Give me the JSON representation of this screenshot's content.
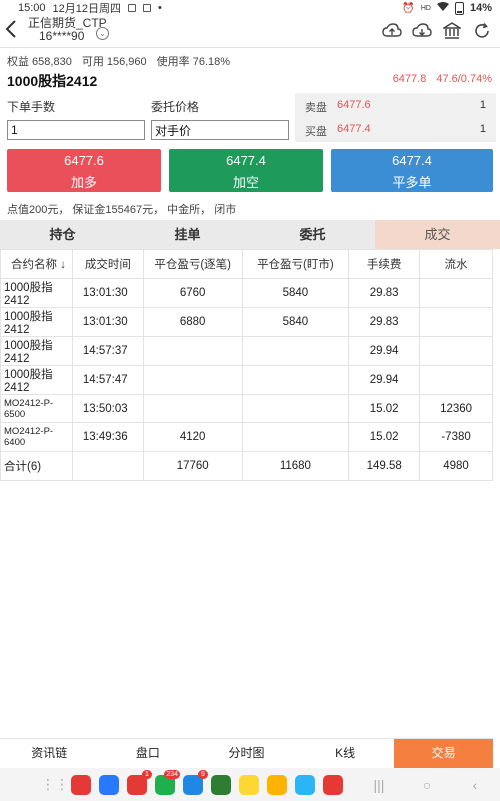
{
  "status": {
    "time": "15:00",
    "date": "12月12日周四",
    "battery": "14%",
    "net": "HD"
  },
  "header": {
    "account_name": "正信期货_CTP",
    "account_id": "16****90"
  },
  "equity": {
    "equity": "权益 658,830",
    "available": "可用 156,960",
    "usage": "使用率 76.18%"
  },
  "contract": {
    "name": "1000股指2412",
    "last_price": "6477.8",
    "change": "47.6/0.74%"
  },
  "order_form": {
    "qty_label": "下单手数",
    "qty_value": "1",
    "price_label": "委托价格",
    "price_value": "对手价"
  },
  "book": {
    "ask_label": "卖盘",
    "ask_price": "6477.6",
    "ask_qty": "1",
    "bid_label": "买盘",
    "bid_price": "6477.4",
    "bid_qty": "1"
  },
  "buttons": {
    "buy": {
      "price": "6477.6",
      "label": "加多"
    },
    "sell": {
      "price": "6477.4",
      "label": "加空"
    },
    "close": {
      "price": "6477.4",
      "label": "平多单"
    }
  },
  "info_line": "点值200元， 保证金155467元， 中金所， 闭市",
  "tabs": [
    "持仓",
    "挂单",
    "委托",
    "成交"
  ],
  "trades": {
    "headers": [
      "合约名称 ↓",
      "成交时间",
      "平仓盈亏(逐笔)",
      "平仓盈亏(盯市)",
      "手续费",
      "流水"
    ],
    "rows": [
      {
        "name": "1000股指2412",
        "time": "13:01:30",
        "pnl_trade": "6760",
        "pnl_mtm": "5840",
        "fee": "29.83",
        "flow": ""
      },
      {
        "name": "1000股指2412",
        "time": "13:01:30",
        "pnl_trade": "6880",
        "pnl_mtm": "5840",
        "fee": "29.83",
        "flow": ""
      },
      {
        "name": "1000股指2412",
        "time": "14:57:37",
        "pnl_trade": "",
        "pnl_mtm": "",
        "fee": "29.94",
        "flow": ""
      },
      {
        "name": "1000股指2412",
        "time": "14:57:47",
        "pnl_trade": "",
        "pnl_mtm": "",
        "fee": "29.94",
        "flow": ""
      },
      {
        "name": "MO2412-P-6500",
        "time": "13:50:03",
        "pnl_trade": "",
        "pnl_mtm": "",
        "fee": "15.02",
        "flow": "12360"
      },
      {
        "name": "MO2412-P-6400",
        "time": "13:49:36",
        "pnl_trade": "4120",
        "pnl_mtm": "",
        "fee": "15.02",
        "flow": "-7380"
      }
    ],
    "total": {
      "name": "合计(6)",
      "time": "",
      "pnl_trade": "17760",
      "pnl_mtm": "11680",
      "fee": "149.58",
      "flow": "4980"
    }
  },
  "bottom_nav": [
    "资讯链",
    "盘口",
    "分时图",
    "K线",
    "交易"
  ],
  "dock": [
    {
      "name": "app-1",
      "color": "#e53935",
      "badge": ""
    },
    {
      "name": "app-2",
      "color": "#2979ff",
      "badge": ""
    },
    {
      "name": "app-3",
      "color": "#e53935",
      "badge": "1"
    },
    {
      "name": "wechat",
      "color": "#20b04b",
      "badge": "234"
    },
    {
      "name": "app-5",
      "color": "#1e88e5",
      "badge": "9"
    },
    {
      "name": "calculator",
      "color": "#2e7d32",
      "badge": ""
    },
    {
      "name": "app-7",
      "color": "#fdd835",
      "badge": ""
    },
    {
      "name": "app-8",
      "color": "#ffb300",
      "badge": ""
    },
    {
      "name": "app-9",
      "color": "#29b6f6",
      "badge": ""
    },
    {
      "name": "app-10",
      "color": "#e53935",
      "badge": ""
    }
  ]
}
